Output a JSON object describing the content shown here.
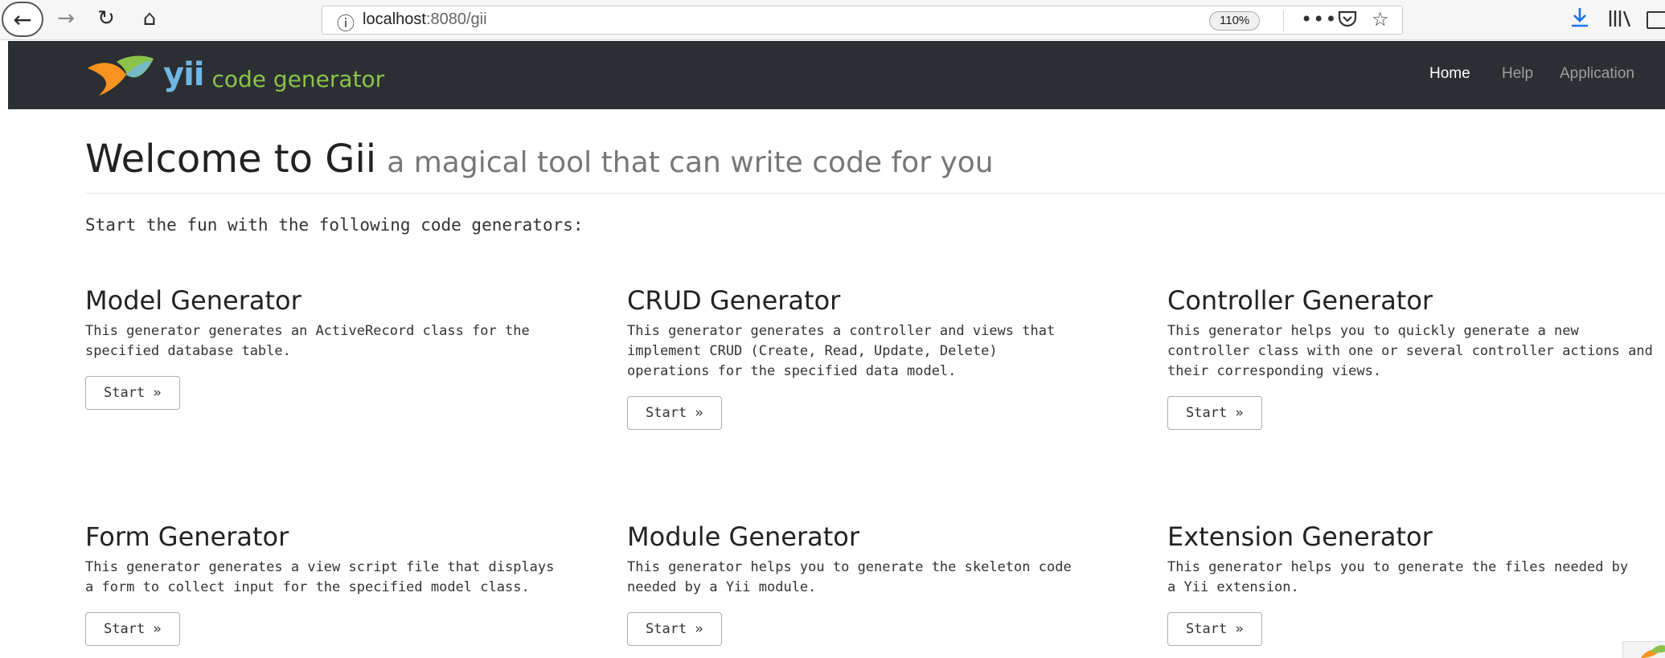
{
  "browser": {
    "url_info_icon": "info-icon",
    "url_host": "localhost",
    "url_rest": ":8080/gii",
    "zoom": "110%",
    "icons": [
      "back-arrow-icon",
      "forward-arrow-icon",
      "reload-icon",
      "home-icon",
      "more-icon",
      "pocket-icon",
      "bookmark-star-icon",
      "download-icon",
      "library-icon",
      "sidebar-icon"
    ]
  },
  "navbar": {
    "brand_yii": "yii",
    "brand_text": "code generator",
    "links": [
      {
        "label": "Home"
      },
      {
        "label": "Help"
      },
      {
        "label": "Application"
      }
    ]
  },
  "main": {
    "title": "Welcome to Gii",
    "subtitle": "a magical tool that can write code for you",
    "lead": "Start the fun with the following code generators:",
    "generators": [
      {
        "title": "Model Generator",
        "description": "This generator generates an ActiveRecord class for the\nspecified database table.",
        "button": "Start »"
      },
      {
        "title": "CRUD Generator",
        "description": "This generator generates a controller and views that\nimplement CRUD (Create, Read, Update, Delete)\noperations for the specified data model.",
        "button": "Start »"
      },
      {
        "title": "Controller Generator",
        "description": "This generator helps you to quickly generate a new\ncontroller class with one or several controller actions and\ntheir corresponding views.",
        "button": "Start »"
      },
      {
        "title": "Form Generator",
        "description": "This generator generates a view script file that displays\na form to collect input for the specified model class.",
        "button": "Start »"
      },
      {
        "title": "Module Generator",
        "description": "This generator helps you to generate the skeleton code\nneeded by a Yii module.",
        "button": "Start »"
      },
      {
        "title": "Extension Generator",
        "description": "This generator helps you to generate the files needed by\na Yii extension.",
        "button": "Start »"
      }
    ]
  },
  "colors": {
    "navbar_bg": "#2b2f33",
    "brand_blue": "#6fb7e6",
    "brand_green": "#8bc34a",
    "logo_orange": "#f7931e"
  }
}
